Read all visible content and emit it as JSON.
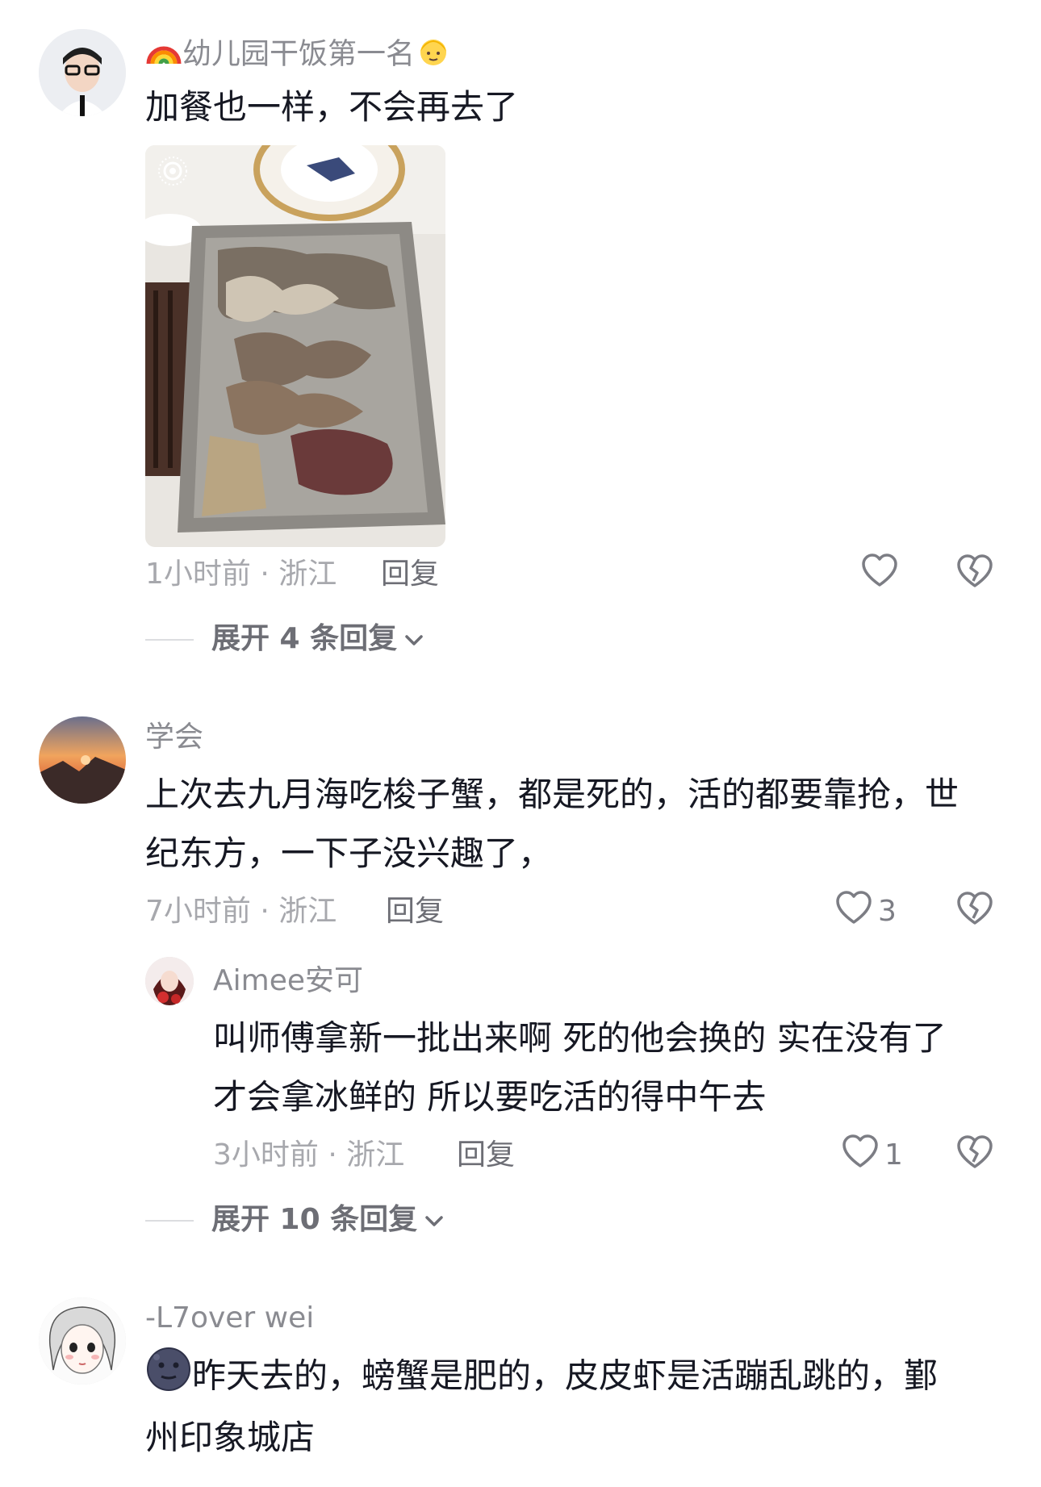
{
  "comments": [
    {
      "username": "幼儿园干饭第一名",
      "text": "加餐也一样，不会再去了",
      "time_location": "1小时前 · 浙江",
      "reply_label": "回复",
      "like_count": "",
      "expand_label": "展开 4 条回复",
      "icons": [
        "rainbow-emoji",
        "girl-emoji",
        "heart-icon",
        "broken-heart-icon",
        "chevron-down-icon",
        "live-photo-icon"
      ]
    },
    {
      "username": "学会",
      "text_line1": "上次去九月海吃梭子蟹，都是死的，活的都要靠抢，世",
      "text_line2": "纪东方，一下子没兴趣了，",
      "time_location": "7小时前 · 浙江",
      "reply_label": "回复",
      "like_count": "3",
      "reply": {
        "username": "Aimee安可",
        "text_line1": "叫师傅拿新一批出来啊 死的他会换的 实在没有了",
        "text_line2": "才会拿冰鲜的 所以要吃活的得中午去",
        "time_location": "3小时前 · 浙江",
        "reply_label": "回复",
        "like_count": "1"
      },
      "expand_label": "展开 10 条回复"
    },
    {
      "username": "-L7over wei",
      "text_line1": "昨天去的，螃蟹是肥的，皮皮虾是活蹦乱跳的，鄞",
      "text_line2": "州印象城店",
      "icons": [
        "dark-moon-face-emoji"
      ]
    }
  ],
  "colors": {
    "text": "#161823",
    "meta": "#a7a8ad",
    "username": "#8a8b91"
  }
}
